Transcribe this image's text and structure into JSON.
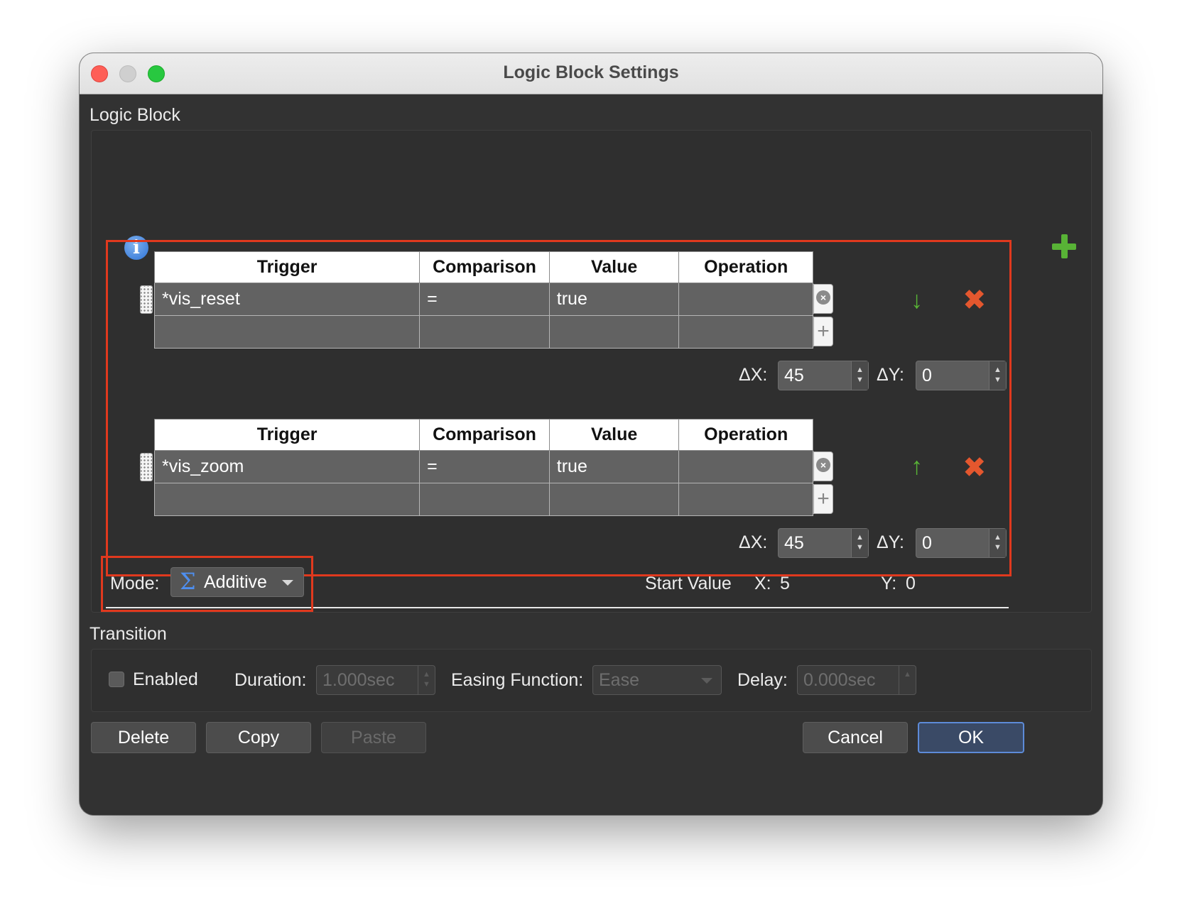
{
  "window": {
    "title": "Logic Block Settings"
  },
  "logic_block": {
    "section_label": "Logic Block",
    "columns": [
      "Trigger",
      "Comparison",
      "Value",
      "Operation"
    ],
    "blocks": [
      {
        "rows": [
          {
            "trigger": "*vis_reset",
            "comparison": "=",
            "value": "true",
            "operation": ""
          },
          {
            "trigger": "",
            "comparison": "",
            "value": "",
            "operation": ""
          }
        ],
        "move_direction": "down",
        "dx_label": "ΔX:",
        "dx_value": "45",
        "dy_label": "ΔY:",
        "dy_value": "0"
      },
      {
        "rows": [
          {
            "trigger": "*vis_zoom",
            "comparison": "=",
            "value": "true",
            "operation": ""
          },
          {
            "trigger": "",
            "comparison": "",
            "value": "",
            "operation": ""
          }
        ],
        "move_direction": "up",
        "dx_label": "ΔX:",
        "dx_value": "45",
        "dy_label": "ΔY:",
        "dy_value": "0"
      }
    ],
    "mode_label": "Mode:",
    "mode_value": "Additive",
    "start_value_label": "Start Value",
    "start_x_label": "X:",
    "start_x_value": "5",
    "start_y_label": "Y:",
    "start_y_value": "0"
  },
  "transition": {
    "section_label": "Transition",
    "enabled_label": "Enabled",
    "enabled": false,
    "duration_label": "Duration:",
    "duration_value": "1.000sec",
    "easing_label": "Easing Function:",
    "easing_value": "Ease",
    "delay_label": "Delay:",
    "delay_value": "0.000sec"
  },
  "buttons": {
    "delete": "Delete",
    "copy": "Copy",
    "paste": "Paste",
    "cancel": "Cancel",
    "ok": "OK"
  },
  "icons": {
    "info": "info-icon",
    "add": "plus-icon",
    "move_down": "arrow-down-icon",
    "move_up": "arrow-up-icon",
    "remove": "x-icon",
    "mode": "sigma-icon"
  },
  "colors": {
    "highlight_box": "#e0391e",
    "add_green": "#58b336",
    "remove_orange": "#e4572e",
    "info_blue": "#2e73d6"
  }
}
